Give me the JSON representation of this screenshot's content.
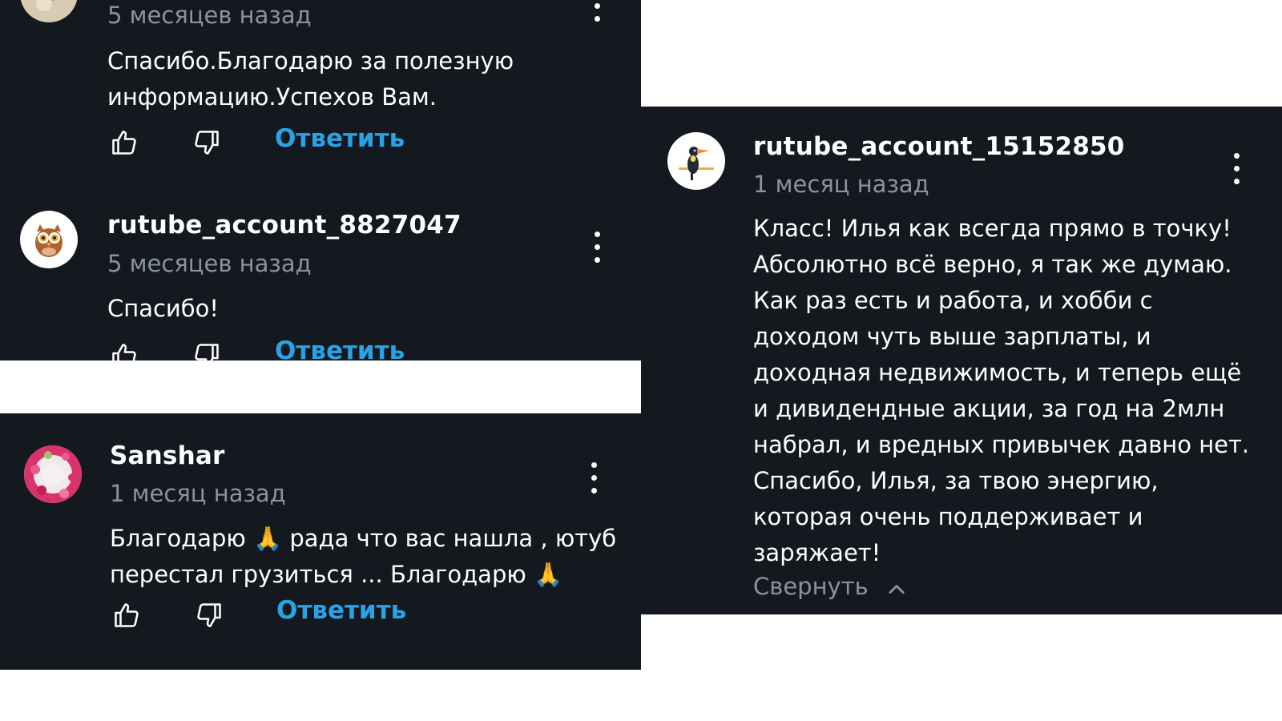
{
  "comments": [
    {
      "time": "5 месяцев назад",
      "text_lines": [
        "Спасибо.Благодарю за полезную",
        "информацию.Успехов Вам."
      ],
      "reply_label": "Ответить"
    },
    {
      "author": "rutube_account_8827047",
      "time": "5 месяцев назад",
      "text_lines": [
        "Спасибо!"
      ],
      "reply_label": "Ответить"
    },
    {
      "author": "Sanshar",
      "time": "1 месяц назад",
      "text_lines": [
        "Благодарю 🙏 рада что вас нашла , ютуб",
        "перестал грузиться ... Благодарю 🙏"
      ],
      "reply_label": "Ответить"
    },
    {
      "author": "rutube_account_15152850",
      "time": "1 месяц назад",
      "text_lines": [
        "Класс! Илья как всегда прямо в точку!",
        "Абсолютно всё верно, я так же думаю.",
        "Как раз есть и работа, и хобби с",
        "доходом чуть выше зарплаты, и",
        "доходная недвижимость, и теперь ещё",
        "и дивидендные акции, за год на 2млн",
        "набрал, и вредных привычек давно нет.",
        "Спасибо, Илья, за твою энергию,",
        "которая очень поддерживает и",
        "заряжает!"
      ],
      "collapse_label": "Свернуть"
    }
  ],
  "icons": {
    "like": "thumbs-up-icon",
    "dislike": "thumbs-down-icon",
    "more": "more-vertical-icon",
    "collapse": "chevron-up-icon"
  },
  "colors": {
    "panel_bg": "#14181f",
    "text": "#ffffff",
    "muted": "#8a93a0",
    "accent": "#2aa3e6"
  }
}
